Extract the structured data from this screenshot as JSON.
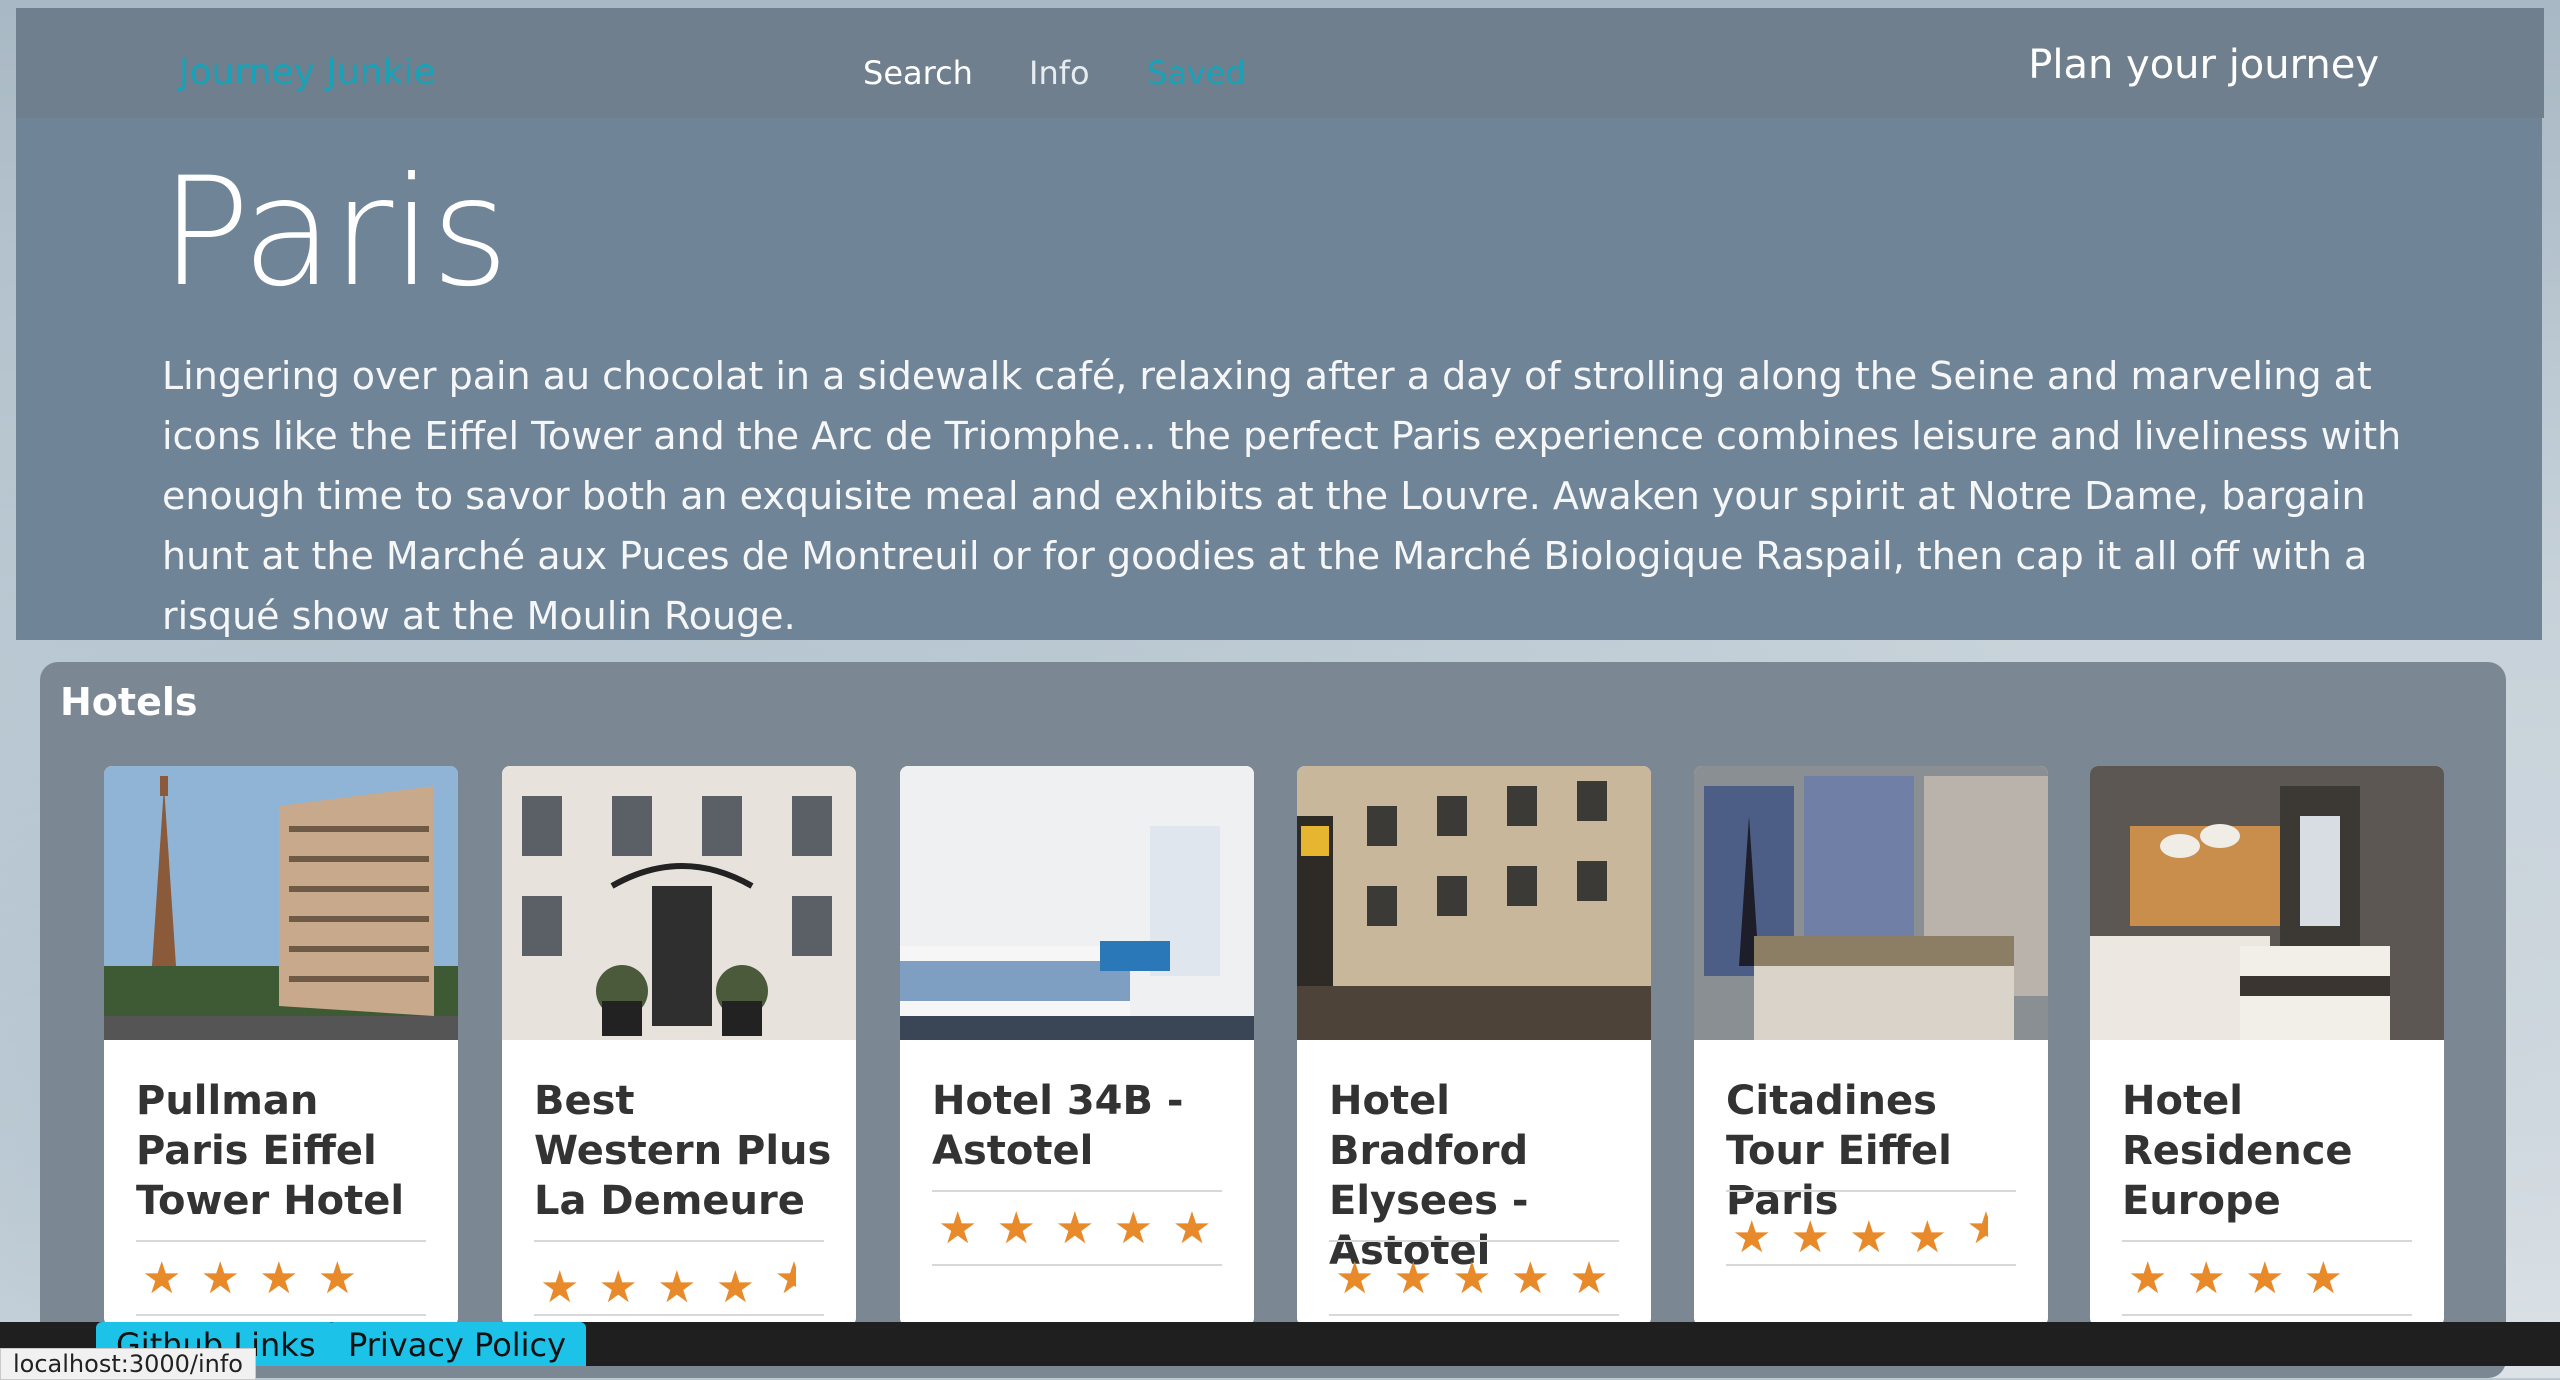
{
  "header": {
    "brand": "Journey Junkie",
    "nav": [
      "Search",
      "Info",
      "Saved"
    ],
    "plan": "Plan your journey"
  },
  "hero": {
    "title": "Paris",
    "description": "Lingering over pain au chocolat in a sidewalk café, relaxing after a day of strolling along the Seine and marveling at icons like the Eiffel Tower and the Arc de Triomphe... the perfect Paris experience combines leisure and liveliness with enough time to savor both an exquisite meal and exhibits at the Louvre. Awaken your spirit at Notre Dame, bargain hunt at the Marché aux Puces de Montreuil or for goodies at the Marché Biologique Raspail, then cap it all off with a risqué show at the Moulin Rouge."
  },
  "hotels": {
    "title": "Hotels",
    "items": [
      {
        "name": "Pullman Paris Eiffel Tower Hotel",
        "rating": 4
      },
      {
        "name": "Best Western Plus La Demeure",
        "rating": 4.5
      },
      {
        "name": "Hotel 34B - Astotel",
        "rating": 5
      },
      {
        "name": "Hotel Bradford Elysees - Astotel",
        "rating": 5
      },
      {
        "name": "Citadines Tour Eiffel Paris",
        "rating": 4.5
      },
      {
        "name": "Hotel Residence Europe",
        "rating": 4
      }
    ]
  },
  "footer": {
    "github": "Github Links",
    "privacy": "Privacy Policy"
  },
  "status_url": "localhost:3000/info",
  "colors": {
    "accent": "#17a2b8",
    "star": "#e8892a",
    "footer_button": "#1dc2e8"
  }
}
